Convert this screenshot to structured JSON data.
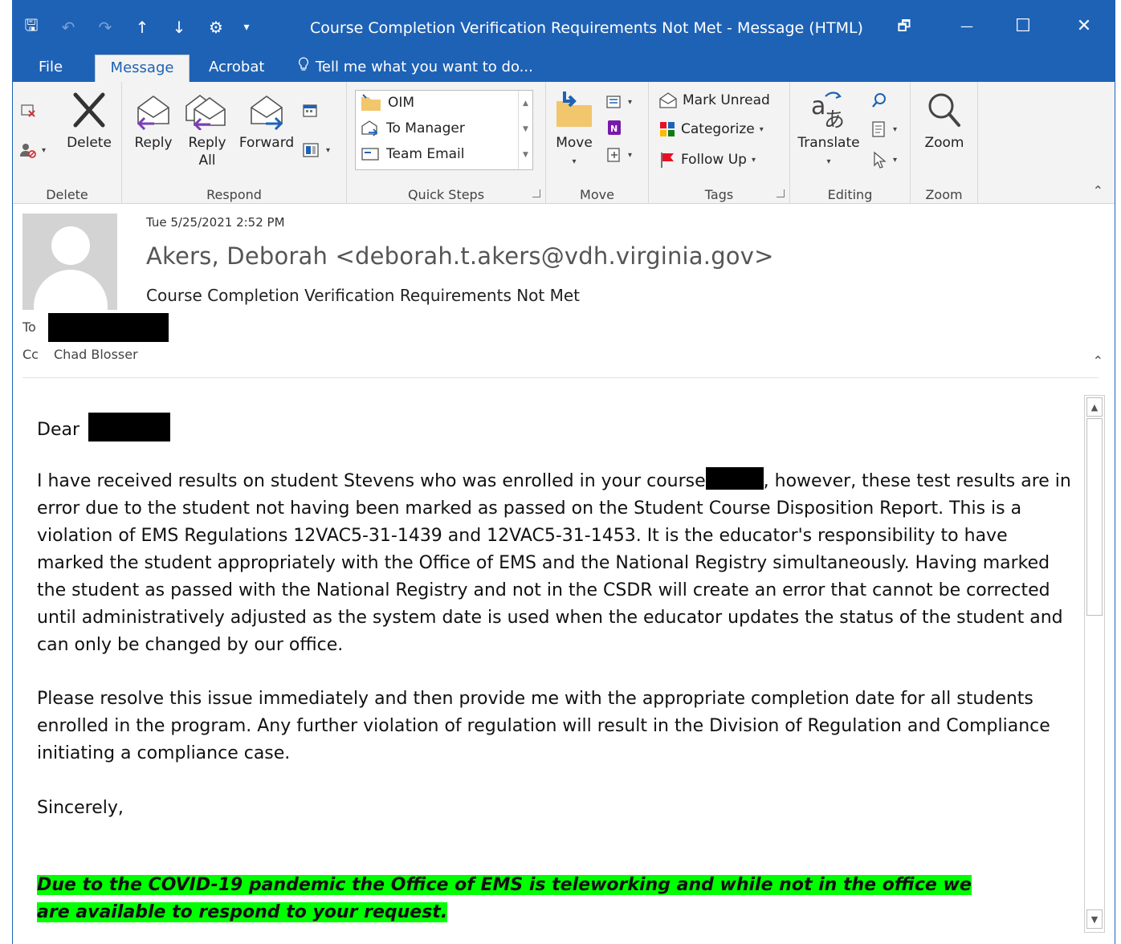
{
  "window": {
    "title": "Course Completion Verification Requirements Not Met - Message (HTML)",
    "restore_glyph": "🗗",
    "minimize_glyph": "—",
    "maximize_glyph": "☐",
    "close_glyph": "✕"
  },
  "qat": {
    "save_glyph": "🖫",
    "undo_glyph": "↶",
    "redo_glyph": "↷",
    "up_glyph": "↑",
    "down_glyph": "↓",
    "customize_glyph": "⚙",
    "more_glyph": "▾"
  },
  "tabs": [
    {
      "label": "File"
    },
    {
      "label": "Message",
      "active": true
    },
    {
      "label": "Acrobat"
    }
  ],
  "tell_me": "Tell me what you want to do...",
  "ribbon": {
    "delete_group": {
      "label": "Delete",
      "delete_label": "Delete"
    },
    "respond_group": {
      "label": "Respond",
      "reply": "Reply",
      "reply_all_1": "Reply",
      "reply_all_2": "All",
      "forward": "Forward"
    },
    "quick_steps_group": {
      "label": "Quick Steps",
      "items": [
        "OIM",
        "To Manager",
        "Team Email"
      ]
    },
    "move_group": {
      "label": "Move",
      "move": "Move"
    },
    "tags_group": {
      "label": "Tags",
      "mark_unread": "Mark Unread",
      "categorize": "Categorize",
      "follow_up": "Follow Up"
    },
    "editing_group": {
      "label": "Editing",
      "translate": "Translate"
    },
    "zoom_group": {
      "label": "Zoom",
      "zoom": "Zoom"
    },
    "collapse_glyph": "⌃"
  },
  "header": {
    "date": "Tue 5/25/2021 2:52 PM",
    "sender": "Akers, Deborah <deborah.t.akers@vdh.virginia.gov>",
    "subject": "Course Completion Verification Requirements Not Met",
    "to_label": "To",
    "cc_label": "Cc",
    "cc_name": "Chad Blosser",
    "collapse_glyph": "⌃"
  },
  "body": {
    "greeting": "Dear",
    "para1_a": "I have received results on student Stevens who was enrolled in your course",
    "para1_b": ", however, these test results are in error due to the student not having been marked as passed on the Student Course Disposition Report. This is a violation of EMS Regulations 12VAC5-31-1439 and 12VAC5-31-1453. It is the educator's responsibility to have marked the student appropriately with the Office of EMS and the National Registry simultaneously. Having marked the student as passed with the National Registry and not in the CSDR will create an error that cannot be corrected until administratively adjusted as the system date is used when the educator updates the status of the student and can only be changed by our office.",
    "para2": "Please resolve this issue immediately and then provide me with the appropriate completion date for all students enrolled in the program. Any further violation of regulation will result in the Division of Regulation and Compliance initiating a compliance case.",
    "closing": "Sincerely,",
    "notice": "Due to the COVID-19 pandemic the Office of EMS is teleworking and while not in the office we are available to respond to your request."
  },
  "colors": {
    "title_bar": "#1e62b6",
    "ribbon": "#f3f3f3",
    "highlight": "#00ff00"
  }
}
